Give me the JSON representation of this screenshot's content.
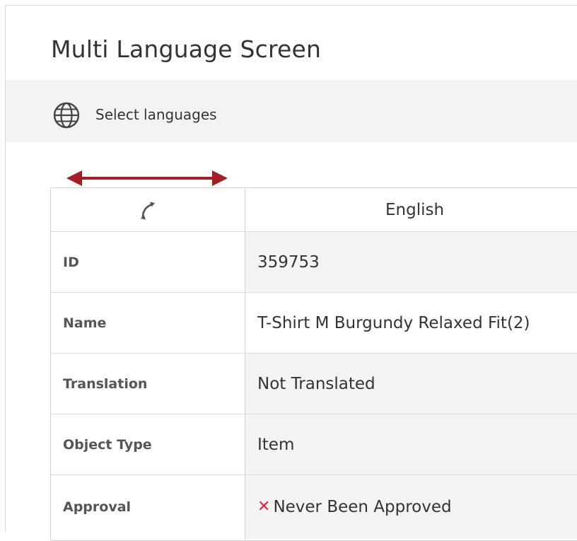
{
  "window": {
    "title": "Multi Language Screen"
  },
  "toolbar": {
    "icon": "globe-icon",
    "select_languages_label": "Select languages"
  },
  "resize_indicator": {
    "icon": "double-headed-arrow-icon",
    "color": "#a61c24"
  },
  "grid": {
    "header": {
      "swap_icon": "swap-arrows-icon",
      "language": "English"
    },
    "rows": [
      {
        "label": "ID",
        "value": "359753"
      },
      {
        "label": "Name",
        "value": "T-Shirt M Burgundy Relaxed Fit(2)"
      },
      {
        "label": "Translation",
        "value": "Not Translated"
      },
      {
        "label": "Object Type",
        "value": "Item"
      },
      {
        "label": "Approval",
        "value": "Never Been Approved",
        "status_icon": "x-icon",
        "status_color": "#e0243b"
      }
    ]
  }
}
